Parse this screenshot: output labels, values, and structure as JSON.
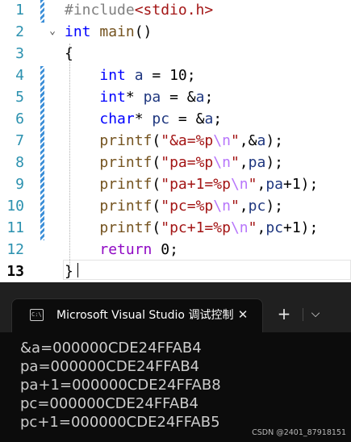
{
  "editor": {
    "line_numbers": [
      "1",
      "2",
      "3",
      "4",
      "5",
      "6",
      "7",
      "8",
      "9",
      "10",
      "11",
      "12",
      "13"
    ],
    "current_line": "13",
    "lines": [
      [
        {
          "t": "#include",
          "c": "pp"
        },
        {
          "t": "<stdio.h>",
          "c": "str"
        }
      ],
      [
        {
          "t": "int",
          "c": "kw"
        },
        {
          "t": " "
        },
        {
          "t": "main",
          "c": "fn"
        },
        {
          "t": "()"
        }
      ],
      [
        {
          "t": "{"
        }
      ],
      [
        {
          "t": "    "
        },
        {
          "t": "int",
          "c": "kw"
        },
        {
          "t": " "
        },
        {
          "t": "a",
          "c": "var"
        },
        {
          "t": " = "
        },
        {
          "t": "10",
          "c": "num"
        },
        {
          "t": ";"
        }
      ],
      [
        {
          "t": "    "
        },
        {
          "t": "int",
          "c": "kw"
        },
        {
          "t": "* "
        },
        {
          "t": "pa",
          "c": "var"
        },
        {
          "t": " = &"
        },
        {
          "t": "a",
          "c": "var"
        },
        {
          "t": ";"
        }
      ],
      [
        {
          "t": "    "
        },
        {
          "t": "char",
          "c": "kw"
        },
        {
          "t": "* "
        },
        {
          "t": "pc",
          "c": "var"
        },
        {
          "t": " = &"
        },
        {
          "t": "a",
          "c": "var"
        },
        {
          "t": ";"
        }
      ],
      [
        {
          "t": "    "
        },
        {
          "t": "printf",
          "c": "fn"
        },
        {
          "t": "("
        },
        {
          "t": "\"&a=%p",
          "c": "str"
        },
        {
          "t": "\\n",
          "c": "esc"
        },
        {
          "t": "\"",
          "c": "str"
        },
        {
          "t": ",&"
        },
        {
          "t": "a",
          "c": "var"
        },
        {
          "t": ");"
        }
      ],
      [
        {
          "t": "    "
        },
        {
          "t": "printf",
          "c": "fn"
        },
        {
          "t": "("
        },
        {
          "t": "\"pa=%p",
          "c": "str"
        },
        {
          "t": "\\n",
          "c": "esc"
        },
        {
          "t": "\"",
          "c": "str"
        },
        {
          "t": ","
        },
        {
          "t": "pa",
          "c": "var"
        },
        {
          "t": ");"
        }
      ],
      [
        {
          "t": "    "
        },
        {
          "t": "printf",
          "c": "fn"
        },
        {
          "t": "("
        },
        {
          "t": "\"pa+1=%p",
          "c": "str"
        },
        {
          "t": "\\n",
          "c": "esc"
        },
        {
          "t": "\"",
          "c": "str"
        },
        {
          "t": ","
        },
        {
          "t": "pa",
          "c": "var"
        },
        {
          "t": "+1);"
        }
      ],
      [
        {
          "t": "    "
        },
        {
          "t": "printf",
          "c": "fn"
        },
        {
          "t": "("
        },
        {
          "t": "\"pc=%p",
          "c": "str"
        },
        {
          "t": "\\n",
          "c": "esc"
        },
        {
          "t": "\"",
          "c": "str"
        },
        {
          "t": ","
        },
        {
          "t": "pc",
          "c": "var"
        },
        {
          "t": ");"
        }
      ],
      [
        {
          "t": "    "
        },
        {
          "t": "printf",
          "c": "fn"
        },
        {
          "t": "("
        },
        {
          "t": "\"pc+1=%p",
          "c": "str"
        },
        {
          "t": "\\n",
          "c": "esc"
        },
        {
          "t": "\"",
          "c": "str"
        },
        {
          "t": ","
        },
        {
          "t": "pc",
          "c": "var"
        },
        {
          "t": "+1);"
        }
      ],
      [
        {
          "t": "    "
        },
        {
          "t": "return",
          "c": "ret"
        },
        {
          "t": " 0;"
        }
      ],
      [
        {
          "t": "}"
        }
      ]
    ],
    "colors": {
      "keyword": "#0000ff",
      "string": "#a31515",
      "escape": "#b776fb",
      "line_number": "#2b91af",
      "change_bar": "#3c8fd8"
    },
    "fold_icon": "chevron-down-icon"
  },
  "console": {
    "tab_title": "Microsoft Visual Studio 调试控制台",
    "tab_icon": "console-icon",
    "close_glyph": "✕",
    "new_tab_glyph": "+",
    "dropdown_glyph": "⌵",
    "output": [
      "&a=000000CDE24FFAB4",
      "pa=000000CDE24FFAB4",
      "pa+1=000000CDE24FFAB8",
      "pc=000000CDE24FFAB4",
      "pc+1=000000CDE24FFAB5"
    ],
    "watermark": "CSDN @2401_87918151"
  }
}
